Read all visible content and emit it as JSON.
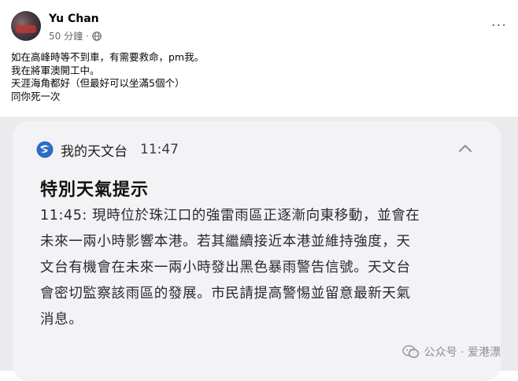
{
  "post": {
    "author": "Yu Chan",
    "time": "50 分鐘",
    "separator": "·",
    "more": "···",
    "lines": [
      "如在高峰時等不到車，有需要救命，pm我。",
      "我在將軍澳開工中。",
      "天涯海角都好（但最好可以坐滿5個个）",
      "同你死一次"
    ]
  },
  "notification": {
    "app_name": "我的天文台",
    "time": "11:47",
    "title": "特別天氣提示",
    "body_lines": [
      "11:45: 現時位於珠江口的強雷雨區正逐漸向東移動，並會在",
      "未來一兩小時影響本港。若其繼續接近本港並維持強度，天",
      "文台有機會在未來一兩小時發出黑色暴雨警告信號。天文台",
      "會密切監察該雨區的發展。市民請提高警惕並留意最新天氣",
      "消息。"
    ]
  },
  "watermark": {
    "text": "公众号 · 爱港漂"
  },
  "colors": {
    "brand_blue": "#2b6cc4",
    "card_bg": "#f3f3f5",
    "meta_gray": "#65676b"
  }
}
